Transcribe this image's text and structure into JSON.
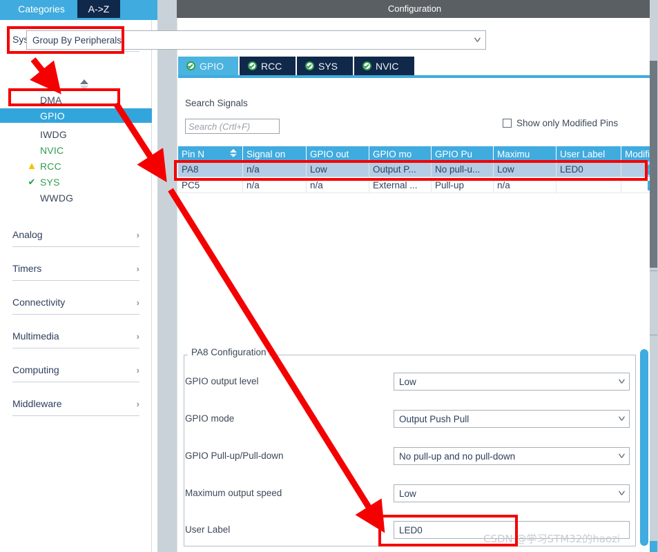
{
  "left_panel": {
    "tabs": [
      {
        "id": "categories",
        "label": "Categories",
        "active": true
      },
      {
        "id": "a-to-z",
        "label": "A->Z",
        "active": false
      }
    ],
    "categories": [
      {
        "label": "System Core",
        "expanded": true,
        "chevron": "chevron-down"
      },
      {
        "label": "Analog",
        "expanded": false,
        "chevron": "chevron-right"
      },
      {
        "label": "Timers",
        "expanded": false,
        "chevron": "chevron-right"
      },
      {
        "label": "Connectivity",
        "expanded": false,
        "chevron": "chevron-right"
      },
      {
        "label": "Multimedia",
        "expanded": false,
        "chevron": "chevron-right"
      },
      {
        "label": "Computing",
        "expanded": false,
        "chevron": "chevron-right"
      },
      {
        "label": "Middleware",
        "expanded": false,
        "chevron": "chevron-right"
      }
    ],
    "peripherals": [
      {
        "name": "DMA",
        "icon": "none",
        "state": "normal",
        "selected": false
      },
      {
        "name": "GPIO",
        "icon": "none",
        "state": "normal",
        "selected": true
      },
      {
        "name": "IWDG",
        "icon": "none",
        "state": "normal",
        "selected": false
      },
      {
        "name": "NVIC",
        "icon": "none",
        "state": "ok",
        "selected": false
      },
      {
        "name": "RCC",
        "icon": "warning-icon",
        "state": "ok",
        "selected": false
      },
      {
        "name": "SYS",
        "icon": "check-icon",
        "state": "ok",
        "selected": false
      },
      {
        "name": "WWDG",
        "icon": "none",
        "state": "normal",
        "selected": false
      }
    ]
  },
  "configuration": {
    "header_title": "Configuration",
    "group_by": {
      "value": "Group By Peripherals"
    },
    "peripheral_tabs": [
      {
        "label": "GPIO",
        "active": true,
        "status_icon": "check-circle-icon"
      },
      {
        "label": "RCC",
        "active": false,
        "status_icon": "check-circle-icon"
      },
      {
        "label": "SYS",
        "active": false,
        "status_icon": "check-circle-icon"
      },
      {
        "label": "NVIC",
        "active": false,
        "status_icon": "check-circle-icon"
      }
    ],
    "search": {
      "label": "Search Signals",
      "placeholder": "Search (Crtl+F)",
      "value": ""
    },
    "show_modified": {
      "label": "Show only Modified Pins",
      "checked": false
    },
    "pin_table": {
      "columns": [
        "Pin N",
        "Signal on",
        "GPIO out",
        "GPIO mo",
        "GPIO Pu",
        "Maximu",
        "User Label",
        "Modified"
      ],
      "sorted_column": "Pin N",
      "rows": [
        {
          "selected": true,
          "pin": "PA8",
          "signal_on": "n/a",
          "gpio_output_level": "Low",
          "gpio_mode": "Output P...",
          "gpio_pull": "No pull-u...",
          "maximum_speed": "Low",
          "user_label": "LED0",
          "modified": true
        },
        {
          "selected": false,
          "pin": "PC5",
          "signal_on": "n/a",
          "gpio_output_level": "n/a",
          "gpio_mode": "External ...",
          "gpio_pull": "Pull-up",
          "maximum_speed": "n/a",
          "user_label": "",
          "modified": true
        }
      ]
    },
    "pin_config": {
      "legend": "PA8 Configuration :",
      "fields": [
        {
          "label": "GPIO output level",
          "value": "Low",
          "type": "select"
        },
        {
          "label": "GPIO mode",
          "value": "Output Push Pull",
          "type": "select"
        },
        {
          "label": "GPIO Pull-up/Pull-down",
          "value": "No pull-up and no pull-down",
          "type": "select"
        },
        {
          "label": "Maximum output speed",
          "value": "Low",
          "type": "select"
        },
        {
          "label": "User Label",
          "value": "LED0",
          "type": "text"
        }
      ]
    }
  },
  "watermark": {
    "text": "CSDN @学习STM32的haozi"
  },
  "annotations": {
    "color": "#f50000",
    "highlight_boxes": [
      {
        "name": "system-core",
        "target": "System Core"
      },
      {
        "name": "gpio-item",
        "target": "GPIO"
      },
      {
        "name": "pa8-row",
        "target": "PA8 table row"
      },
      {
        "name": "user-label-field",
        "target": "User Label input"
      }
    ],
    "arrows": [
      {
        "from": "System Core",
        "to": "GPIO list"
      },
      {
        "from": "GPIO",
        "to": "PA8 table row"
      },
      {
        "from": "PA8 table row",
        "to": "User Label input"
      }
    ]
  }
}
